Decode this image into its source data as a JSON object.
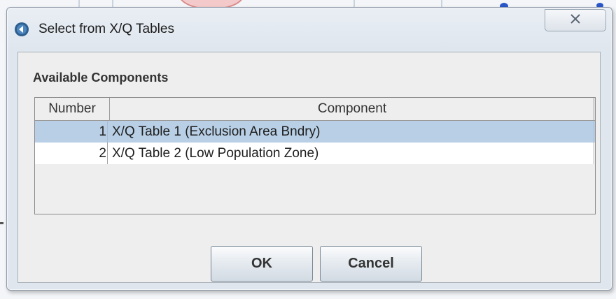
{
  "window": {
    "title": "Select from X/Q Tables",
    "close_icon": "close-icon"
  },
  "panel": {
    "section_label": "Available Components"
  },
  "table": {
    "headers": {
      "number": "Number",
      "component": "Component"
    },
    "rows": [
      {
        "number": "1",
        "component": "X/Q Table 1 (Exclusion Area Bndry)",
        "selected": true
      },
      {
        "number": "2",
        "component": "X/Q Table 2 (Low Population Zone)",
        "selected": false
      }
    ]
  },
  "buttons": {
    "ok": "OK",
    "cancel": "Cancel"
  },
  "colors": {
    "selection": "#b8cfe5",
    "window_bg": "#dfe6ee",
    "panel_bg": "#eeeeee"
  }
}
